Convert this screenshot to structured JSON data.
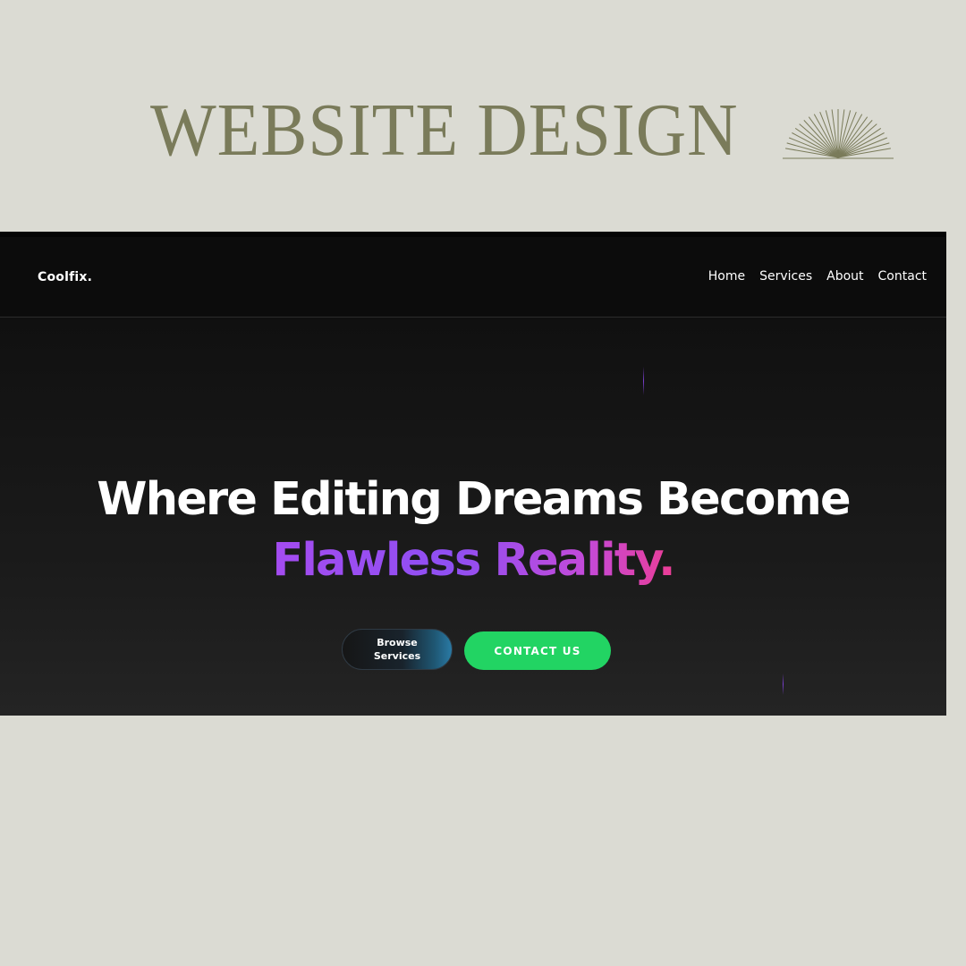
{
  "poster": {
    "title": "WEBSITE DESIGN"
  },
  "site": {
    "logo": "Coolfix.",
    "nav": [
      {
        "label": "Home"
      },
      {
        "label": "Services"
      },
      {
        "label": "About"
      },
      {
        "label": "Contact"
      }
    ],
    "hero": {
      "heading_line1": "Where Editing Dreams Become",
      "heading_line2": "Flawless Reality.",
      "browse_button": "Browse Services",
      "contact_button": "CONTACT US"
    }
  },
  "colors": {
    "background": "#dbdbd3",
    "title_olive": "#7a7b5a",
    "site_dark": "#0c0c0c",
    "accent_green": "#22d463",
    "gradient_purple": "#8f4ff2",
    "gradient_pink": "#ec3d95"
  },
  "icons": {
    "sunburst": "sunburst-icon",
    "hero_lines": "decorative-line"
  }
}
